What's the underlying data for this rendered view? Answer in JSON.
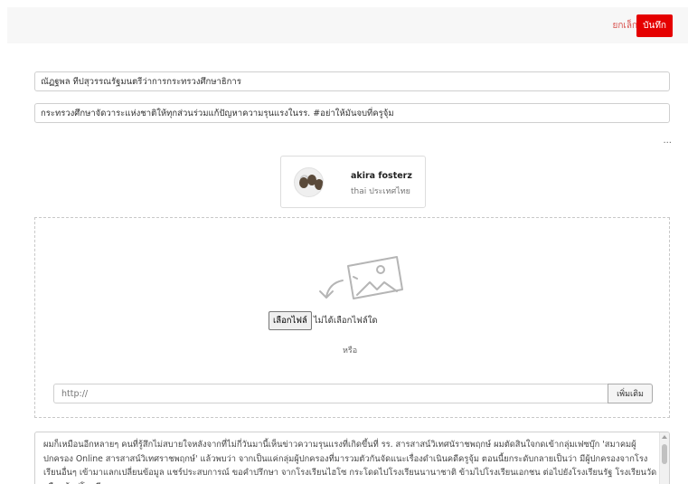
{
  "toolbar": {
    "cancel_label": "ยกเล็ก",
    "save_label": "บันทึก",
    "save_color": "#e50000",
    "cancel_color": "#d9534f"
  },
  "form": {
    "title": "ณัฏฐพล ทีปสุวรรณรัฐมนตรีว่าการกระทรวงศึกษาธิการ",
    "subtitle": "กระทรวงศึกษาจัดวาระแห่งชาติให้ทุกส่วนร่วมแก้ปัญหาความรุนแรงในรร. #อย่าให้มันจบที่ครูจุ้ม",
    "more": "..."
  },
  "author": {
    "name": "akira fosterz",
    "country": "thai ประเทศไทย"
  },
  "upload": {
    "icon": "image-upload-icon",
    "choose_file_label": "เลือกไฟล์",
    "no_file_text": "ไม่ได้เลือกไฟล์ใด",
    "or_text": "หรือ",
    "url_placeholder": "http://",
    "add_label": "เพิ่มเติม"
  },
  "body": {
    "text": "ผมก็เหมือนอีกหลายๆ คนที่รู้สึกไม่สบายใจหลังจากที่ไม่กี่วันมานี้เห็นข่าวความรุนแรงที่เกิดขึ้นที่ รร. สารสาสน์วิเทศนัราชพฤกษ์ ผมตัดสินใจกดเข้ากลุ่มเฟซบุ๊ก 'สมาคมผู้ปกครอง Online สารสาสน์วิเทศราชพฤกษ์' แล้วพบว่า จากเป็นแค่กลุ่มผู้ปกครองที่มารวมตัวกันจัดแนะเรื่องดำเนินคดีครูจุ้ม ตอนนี้ยกระดับกลายเป็นว่า มีผู้ปกครองจากโรงเรียนอื่นๆ เข้ามาแลกเปลี่ยนข้อมูล แชร์ประสบการณ์ ขอคำปรึกษา จากโรงเรียนไฮโซ กระโดดไปโรงเรียนนานาชาติ ข้ามไปโรงเรียนเอกชน ต่อไปยังโรงเรียนรัฐ โรงเรียนวัด หรือแม้แต่โรงเรียนชายแดน"
  }
}
